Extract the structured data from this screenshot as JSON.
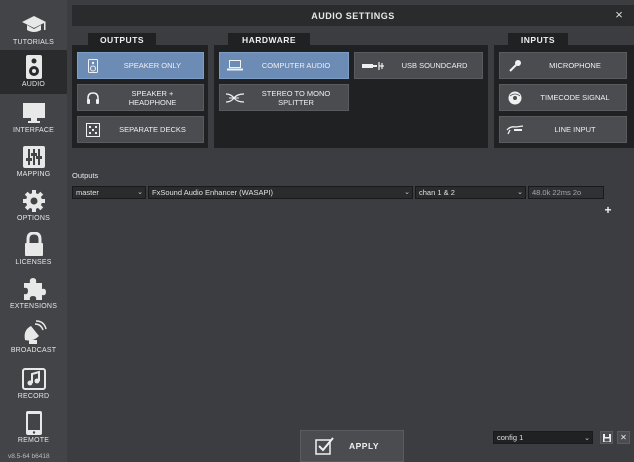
{
  "window": {
    "title": "AUDIO SETTINGS",
    "close_glyph": "×"
  },
  "sidebar": {
    "items": [
      {
        "label": "TUTORIALS",
        "icon": "graduation-cap-icon"
      },
      {
        "label": "AUDIO",
        "icon": "speaker-icon",
        "active": true
      },
      {
        "label": "INTERFACE",
        "icon": "monitor-icon"
      },
      {
        "label": "MAPPING",
        "icon": "sliders-icon"
      },
      {
        "label": "OPTIONS",
        "icon": "gear-icon"
      },
      {
        "label": "LICENSES",
        "icon": "lock-icon"
      },
      {
        "label": "EXTENSIONS",
        "icon": "puzzle-icon"
      },
      {
        "label": "BROADCAST",
        "icon": "satellite-icon"
      },
      {
        "label": "RECORD",
        "icon": "music-note-icon"
      },
      {
        "label": "REMOTE",
        "icon": "phone-icon"
      }
    ],
    "version": "v8.5-64 b6418"
  },
  "outputs_panel": {
    "header": "OUTPUTS",
    "buttons": [
      {
        "label": "SPEAKER ONLY",
        "icon": "speaker-icon",
        "selected": true
      },
      {
        "label": "SPEAKER + HEADPHONE",
        "icon": "headphones-icon",
        "selected": false
      },
      {
        "label": "SEPARATE DECKS",
        "icon": "decks-icon",
        "selected": false
      }
    ]
  },
  "hardware_panel": {
    "header": "HARDWARE",
    "buttons": [
      {
        "label": "COMPUTER AUDIO",
        "icon": "laptop-icon",
        "selected": true
      },
      {
        "label": "USB SOUNDCARD",
        "icon": "usb-icon",
        "selected": false
      },
      {
        "label": "STEREO TO MONO SPLITTER",
        "icon": "splitter-icon",
        "selected": false
      }
    ]
  },
  "inputs_panel": {
    "header": "INPUTS",
    "buttons": [
      {
        "label": "MICROPHONE",
        "icon": "microphone-icon",
        "selected": false
      },
      {
        "label": "TIMECODE SIGNAL",
        "icon": "vinyl-icon",
        "selected": false
      },
      {
        "label": "LINE INPUT",
        "icon": "turntable-icon",
        "selected": false
      }
    ]
  },
  "outputs_config": {
    "label": "Outputs",
    "rows": [
      {
        "channel": "master",
        "device": "FxSound Audio Enhancer (WASAPI)",
        "channels": "chan 1 & 2",
        "latency": "48.0k 22ms 2o"
      }
    ],
    "add_glyph": "+"
  },
  "footer": {
    "apply_label": "APPLY",
    "config_value": "config 1",
    "save_glyph": "💾",
    "delete_glyph": "✕"
  },
  "colors": {
    "background": "#3c3d40",
    "panel": "#202123",
    "selected": "#6d8cb5",
    "button": "#4b4c50"
  }
}
